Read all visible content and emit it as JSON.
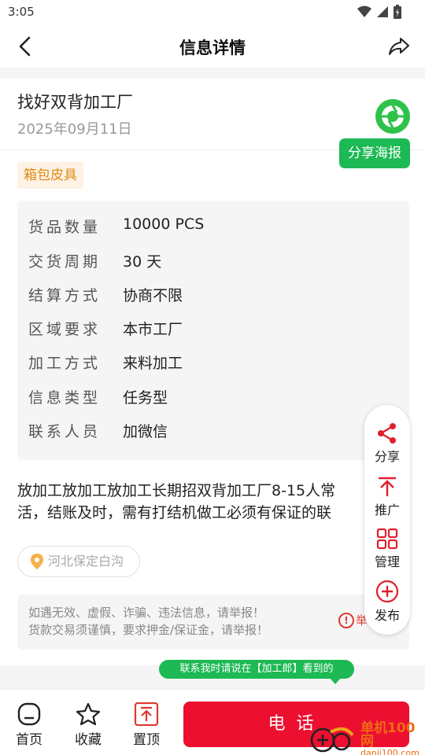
{
  "status_bar": {
    "time": "3:05"
  },
  "header": {
    "title": "信息详情"
  },
  "post": {
    "title": "找好双背加工厂",
    "date": "2025年09月11日",
    "tag": "箱包皮具",
    "share_poster_label": "分享海报"
  },
  "specs": [
    {
      "key": "货品数量",
      "value": "10000 PCS"
    },
    {
      "key": "交货周期",
      "value": "30 天"
    },
    {
      "key": "结算方式",
      "value": "协商不限"
    },
    {
      "key": "区域要求",
      "value": "本市工厂"
    },
    {
      "key": "加工方式",
      "value": "来料加工"
    },
    {
      "key": "信息类型",
      "value": "任务型"
    },
    {
      "key": "联系人员",
      "value": "加微信"
    }
  ],
  "description": {
    "line1": "放加工放加工放加工长期招双背加工厂8-15人常",
    "line2": "活，结账及时，需有打结机做工必须有保证的联"
  },
  "location": "河北保定白沟",
  "warning": {
    "line1": "如遇无效、虚假、诈骗、违法信息，请举报！",
    "line2": "货款交易须谨慎，要求押金/保证金，请举报！",
    "report_label": "举"
  },
  "side_menu": {
    "share": "分享",
    "promote": "推广",
    "manage": "管理",
    "publish": "发布"
  },
  "contact_hint": "联系我时请说在【加工郎】看到的",
  "bottom_bar": {
    "home": "首页",
    "favorite": "收藏",
    "pin_top": "置顶",
    "call": "电话"
  },
  "watermark": {
    "brand": "单机100网",
    "url": "danji100.com"
  },
  "colors": {
    "accent_green": "#1db954",
    "call_red": "#ec0f2f",
    "tag_orange": "#e08a14",
    "pin_red": "#e0382e"
  }
}
